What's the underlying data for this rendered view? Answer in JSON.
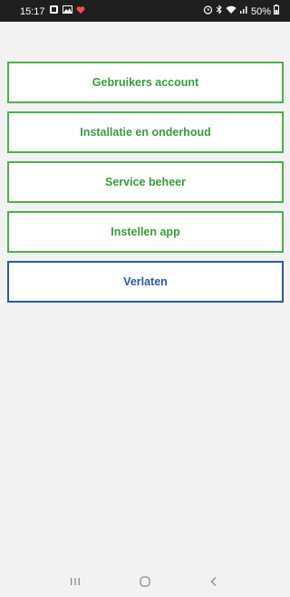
{
  "status_bar": {
    "time": "15:17",
    "battery": "50%",
    "icons_left": [
      "notification-icon",
      "image-icon",
      "heart-icon"
    ],
    "icons_right": [
      "alarm-icon",
      "bluetooth-icon",
      "wifi-icon",
      "signal-icon",
      "battery-icon"
    ]
  },
  "menu": {
    "items": [
      {
        "label": "Gebruikers account"
      },
      {
        "label": "Installatie en onderhoud"
      },
      {
        "label": "Service beheer"
      },
      {
        "label": "Instellen app"
      },
      {
        "label": "Verlaten"
      }
    ]
  },
  "colors": {
    "accent_green": "#4caf50",
    "exit_blue": "#2d5a9e",
    "background": "#f2f2f2",
    "status_bar": "#1f1f1f"
  },
  "nav_bar": {
    "icons": [
      "recent-apps-icon",
      "home-icon",
      "back-icon"
    ]
  }
}
